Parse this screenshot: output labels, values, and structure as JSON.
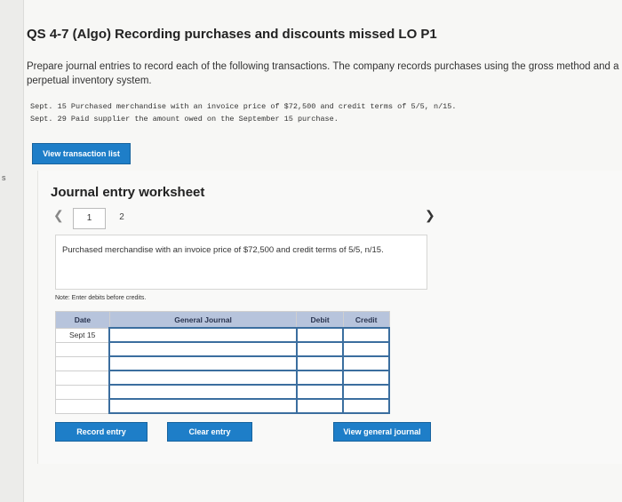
{
  "title": "QS 4-7 (Algo) Recording purchases and discounts missed LO P1",
  "instructions": "Prepare journal entries to record each of the following transactions. The company records purchases using the gross method and a perpetual inventory system.",
  "transactions": [
    "Sept. 15 Purchased merchandise with an invoice price of $72,500 and credit terms of 5/5, n/15.",
    "Sept. 29 Paid supplier the amount owed on the September 15 purchase."
  ],
  "left_mark": "s",
  "view_transaction_button": "View transaction list",
  "worksheet": {
    "title": "Journal entry worksheet",
    "tabs": [
      "1",
      "2"
    ],
    "description": "Purchased merchandise with an invoice price of $72,500 and credit terms of 5/5, n/15.",
    "note": "Note: Enter debits before credits.",
    "columns": [
      "Date",
      "General Journal",
      "Debit",
      "Credit"
    ],
    "rows": [
      {
        "date": "Sept 15",
        "account": "",
        "debit": "",
        "credit": ""
      },
      {
        "date": "",
        "account": "",
        "debit": "",
        "credit": ""
      },
      {
        "date": "",
        "account": "",
        "debit": "",
        "credit": ""
      },
      {
        "date": "",
        "account": "",
        "debit": "",
        "credit": ""
      },
      {
        "date": "",
        "account": "",
        "debit": "",
        "credit": ""
      },
      {
        "date": "",
        "account": "",
        "debit": "",
        "credit": ""
      }
    ],
    "record_button": "Record entry",
    "clear_button": "Clear entry",
    "general_journal_button": "View general journal"
  },
  "colors": {
    "accent": "#1e7ec8",
    "header": "#b7c4dc",
    "cell_border": "#3b6e9f"
  }
}
